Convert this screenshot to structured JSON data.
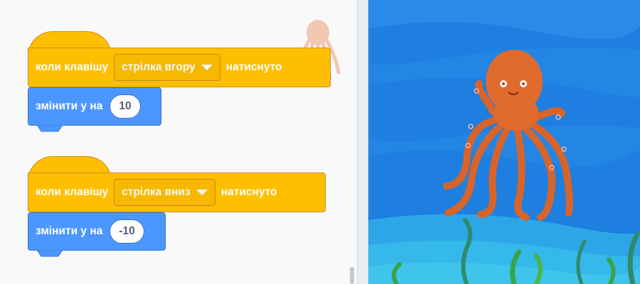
{
  "colors": {
    "events": "#ffbf00",
    "events_border": "#cf8b17",
    "motion": "#4c97ff",
    "motion_border": "#3373cc",
    "stage_water": "#1e7fe0",
    "octopus": "#e06b2d"
  },
  "scripts": [
    {
      "hat": {
        "prefix": "коли клавішу",
        "key": "стрілка вгору",
        "suffix": "натиснуто"
      },
      "command": {
        "label": "змінити у на",
        "value": "10"
      }
    },
    {
      "hat": {
        "prefix": "коли клавішу",
        "key": "стрілка вниз",
        "suffix": "натиснуто"
      },
      "command": {
        "label": "змінити у на",
        "value": "-10"
      }
    }
  ],
  "stage": {
    "sprite_icon": "octopus-sprite",
    "backdrop_icon": "underwater-backdrop"
  }
}
